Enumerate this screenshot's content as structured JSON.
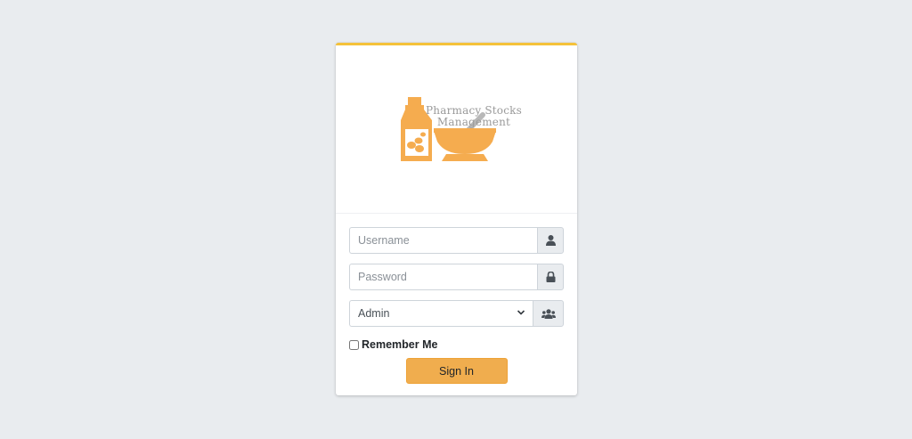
{
  "brand": {
    "logo_text_line1": "Pharmacy Stocks",
    "logo_text_line2": "Management",
    "logo_color": "#f5ac4f"
  },
  "form": {
    "username": {
      "value": "",
      "placeholder": "Username",
      "icon": "user-icon"
    },
    "password": {
      "value": "",
      "placeholder": "Password",
      "icon": "lock-icon"
    },
    "role": {
      "selected": "Admin",
      "icon": "users-icon"
    },
    "remember_label": "Remember Me",
    "remember_checked": false,
    "submit_label": "Sign In"
  },
  "colors": {
    "accent_top_border": "#f5c23a",
    "button": "#f0ad4e",
    "background": "#e9ecef"
  }
}
